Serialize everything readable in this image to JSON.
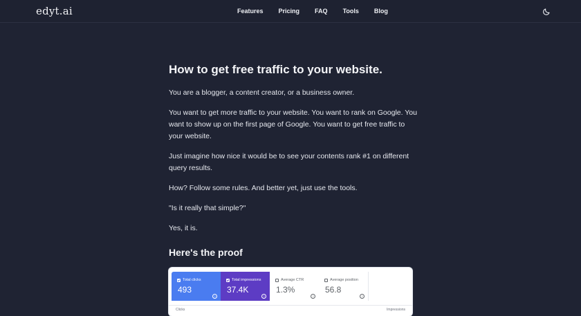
{
  "nav": {
    "logo": "edyt.ai",
    "links": [
      "Features",
      "Pricing",
      "FAQ",
      "Tools",
      "Blog"
    ],
    "theme_icon": "moon-icon"
  },
  "article": {
    "title": "How to get free traffic to your website.",
    "paragraphs": [
      "You are a blogger, a content creator, or a business owner.",
      "You want to get more traffic to your website. You want to rank on Google. You want to show up on the first page of Google. You want to get free traffic to your website.",
      "Just imagine how nice it would be to see your contents rank #1 on different query results.",
      "How? Follow some rules. And better yet, just use the tools.",
      "\"Is it really that simple?\"",
      "Yes, it is."
    ],
    "subheading": "Here's the proof"
  },
  "proof_card": {
    "metrics": [
      {
        "label": "Total clicks",
        "value": "493",
        "checked": true,
        "bg": "#4a7cf0",
        "fg": "#ffffff"
      },
      {
        "label": "Total impressions",
        "value": "37.4K",
        "checked": true,
        "bg": "#5d3cc4",
        "fg": "#ffffff"
      },
      {
        "label": "Average CTR",
        "value": "1.3%",
        "checked": false,
        "bg": "#ffffff",
        "fg": "#5f6368"
      },
      {
        "label": "Average position",
        "value": "56.8",
        "checked": false,
        "bg": "#ffffff",
        "fg": "#5f6368"
      }
    ],
    "bottom_left": "Clicks",
    "bottom_right": "Impressions"
  }
}
